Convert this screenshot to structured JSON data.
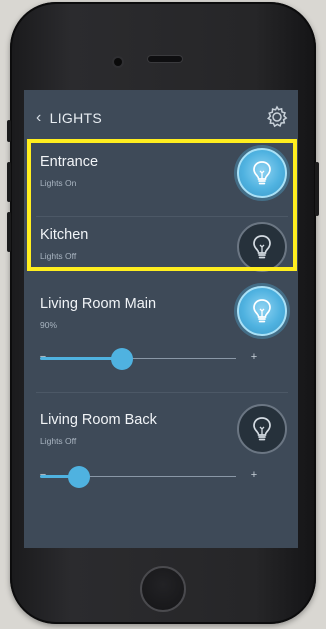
{
  "header": {
    "title": "LIGHTS",
    "back_icon": "chevron-left-icon",
    "settings_icon": "gear-icon"
  },
  "colors": {
    "accent": "#4fb2e0",
    "highlight": "#ffee1f",
    "screen": "#3e4a58"
  },
  "rooms": [
    {
      "name": "Entrance",
      "status": "Lights On",
      "state": "on",
      "icon": "lightbulb-icon"
    },
    {
      "name": "Kitchen",
      "status": "Lights Off",
      "state": "off",
      "icon": "lightbulb-icon"
    },
    {
      "name": "Living Room Main",
      "status": "90%",
      "state": "on",
      "icon": "lightbulb-icon",
      "dimmer_level": 0.42,
      "dimmer_minus": "−",
      "dimmer_plus": "+"
    },
    {
      "name": "Living Room Back",
      "status": "Lights Off",
      "state": "off",
      "icon": "lightbulb-icon",
      "dimmer_level": 0.2,
      "dimmer_minus": "−",
      "dimmer_plus": "+"
    }
  ]
}
